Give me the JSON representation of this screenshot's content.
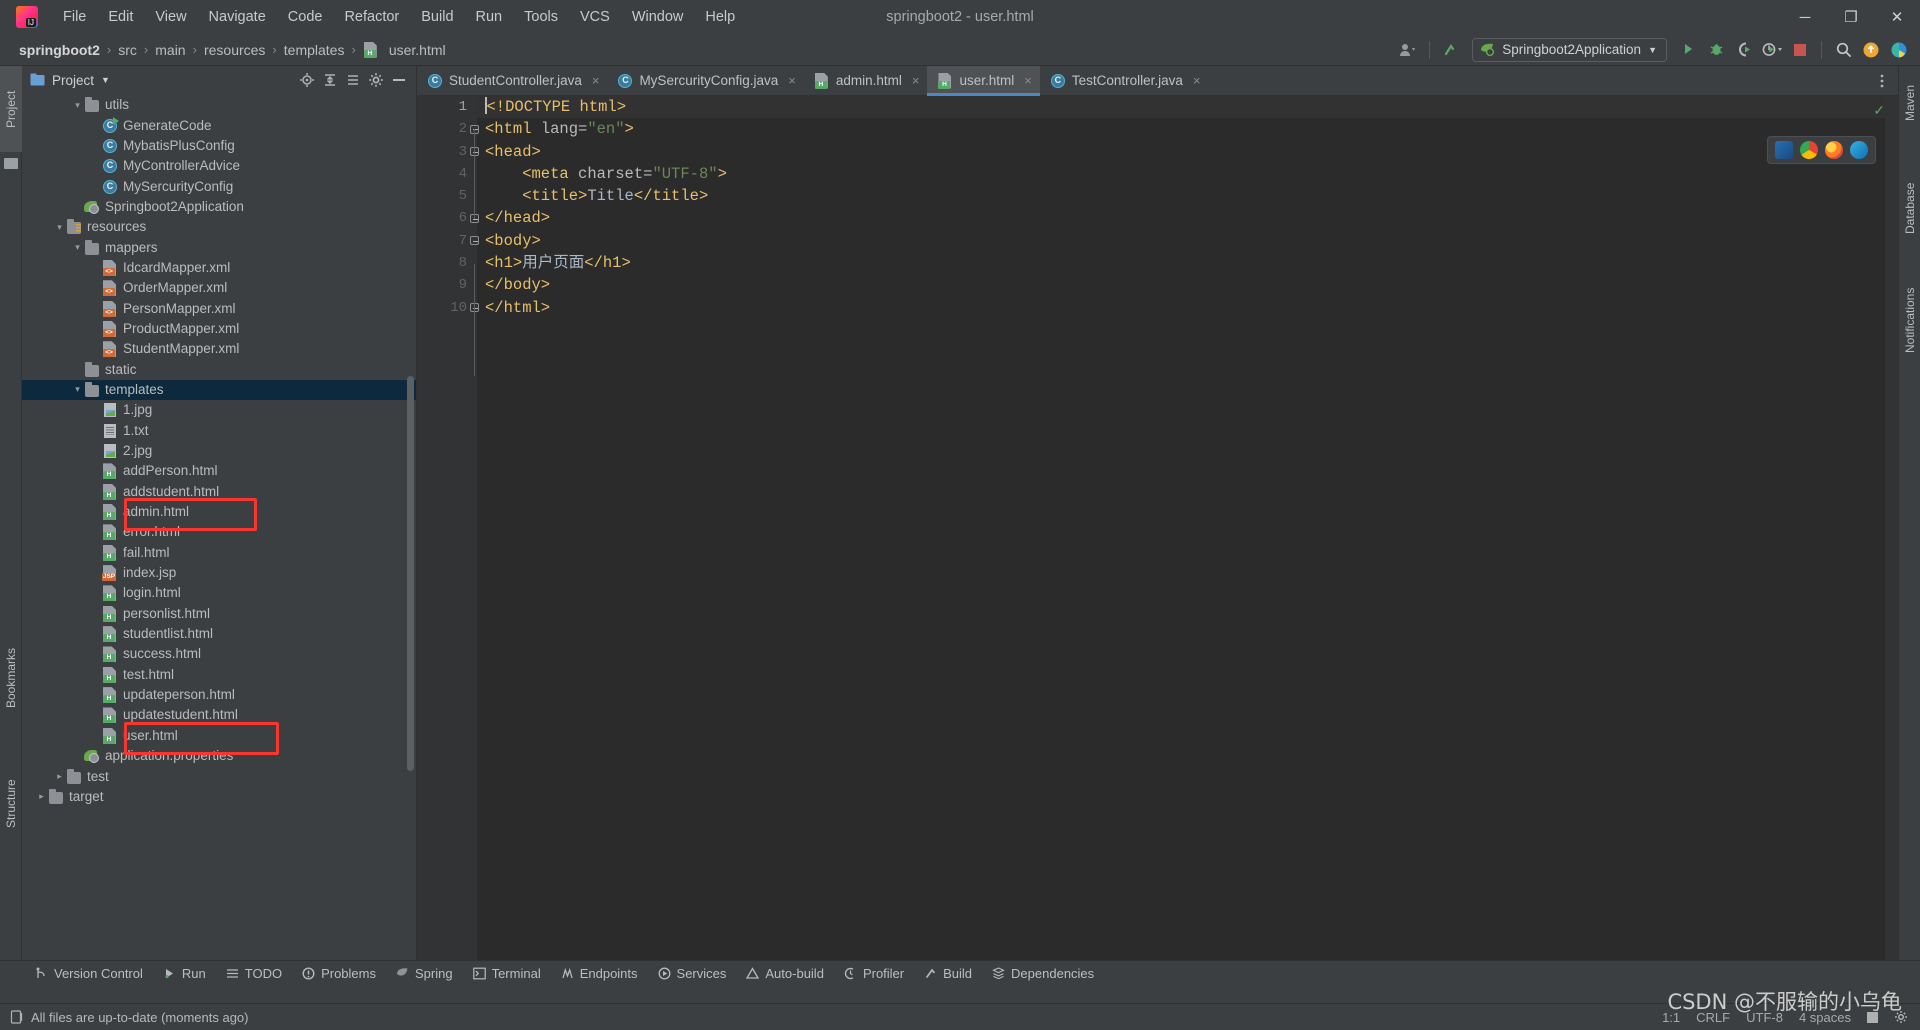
{
  "window": {
    "title": "springboot2 - user.html",
    "controls": {
      "minimize": "─",
      "maximize": "❐",
      "close": "✕"
    }
  },
  "menubar": {
    "items": [
      "File",
      "Edit",
      "View",
      "Navigate",
      "Code",
      "Refactor",
      "Build",
      "Run",
      "Tools",
      "VCS",
      "Window",
      "Help"
    ]
  },
  "breadcrumb": {
    "items": [
      "springboot2",
      "src",
      "main",
      "resources",
      "templates",
      "user.html"
    ],
    "separator": "›"
  },
  "toolbar": {
    "run_config": "Springboot2Application",
    "icons": [
      "user-avatar-icon",
      "updates-icon",
      "run-icon",
      "debug-icon",
      "run-coverage-icon",
      "profiler-icon",
      "stop-icon",
      "search-everywhere-icon",
      "notifications-icon",
      "ide-assistant-icon"
    ]
  },
  "left_tool_strip": {
    "tabs": [
      "Project",
      "Bookmarks",
      "Structure"
    ]
  },
  "right_tool_strip": {
    "tabs": [
      "Maven",
      "Database",
      "Notifications"
    ]
  },
  "project_panel": {
    "title": "Project",
    "header_icons": [
      "locate-icon",
      "expand-all-icon",
      "collapse-all-icon",
      "settings-icon",
      "hide-icon"
    ],
    "tree": [
      {
        "label": "utils",
        "type": "folder",
        "depth": 3,
        "twist": "expanded",
        "selected": false
      },
      {
        "label": "GenerateCode",
        "type": "class-run",
        "depth": 4,
        "twist": "",
        "selected": false
      },
      {
        "label": "MybatisPlusConfig",
        "type": "class",
        "depth": 4,
        "twist": "",
        "selected": false
      },
      {
        "label": "MyControllerAdvice",
        "type": "class",
        "depth": 4,
        "twist": "",
        "selected": false
      },
      {
        "label": "MySercurityConfig",
        "type": "class",
        "depth": 4,
        "twist": "",
        "selected": false
      },
      {
        "label": "Springboot2Application",
        "type": "spring",
        "depth": 3,
        "twist": "",
        "selected": false
      },
      {
        "label": "resources",
        "type": "folder-res",
        "depth": 2,
        "twist": "expanded",
        "selected": false
      },
      {
        "label": "mappers",
        "type": "folder",
        "depth": 3,
        "twist": "expanded",
        "selected": false
      },
      {
        "label": "IdcardMapper.xml",
        "type": "xml",
        "depth": 4,
        "twist": "",
        "selected": false
      },
      {
        "label": "OrderMapper.xml",
        "type": "xml",
        "depth": 4,
        "twist": "",
        "selected": false
      },
      {
        "label": "PersonMapper.xml",
        "type": "xml",
        "depth": 4,
        "twist": "",
        "selected": false
      },
      {
        "label": "ProductMapper.xml",
        "type": "xml",
        "depth": 4,
        "twist": "",
        "selected": false
      },
      {
        "label": "StudentMapper.xml",
        "type": "xml",
        "depth": 4,
        "twist": "",
        "selected": false
      },
      {
        "label": "static",
        "type": "folder",
        "depth": 3,
        "twist": "",
        "selected": false
      },
      {
        "label": "templates",
        "type": "folder",
        "depth": 3,
        "twist": "expanded",
        "selected": true
      },
      {
        "label": "1.jpg",
        "type": "image",
        "depth": 4,
        "twist": "",
        "selected": false
      },
      {
        "label": "1.txt",
        "type": "text",
        "depth": 4,
        "twist": "",
        "selected": false
      },
      {
        "label": "2.jpg",
        "type": "image",
        "depth": 4,
        "twist": "",
        "selected": false
      },
      {
        "label": "addPerson.html",
        "type": "html",
        "depth": 4,
        "twist": "",
        "selected": false
      },
      {
        "label": "addstudent.html",
        "type": "html",
        "depth": 4,
        "twist": "",
        "selected": false
      },
      {
        "label": "admin.html",
        "type": "html",
        "depth": 4,
        "twist": "",
        "selected": false
      },
      {
        "label": "error.html",
        "type": "html",
        "depth": 4,
        "twist": "",
        "selected": false
      },
      {
        "label": "fail.html",
        "type": "html",
        "depth": 4,
        "twist": "",
        "selected": false
      },
      {
        "label": "index.jsp",
        "type": "jsp",
        "depth": 4,
        "twist": "",
        "selected": false
      },
      {
        "label": "login.html",
        "type": "html",
        "depth": 4,
        "twist": "",
        "selected": false
      },
      {
        "label": "personlist.html",
        "type": "html",
        "depth": 4,
        "twist": "",
        "selected": false
      },
      {
        "label": "studentlist.html",
        "type": "html",
        "depth": 4,
        "twist": "",
        "selected": false
      },
      {
        "label": "success.html",
        "type": "html",
        "depth": 4,
        "twist": "",
        "selected": false
      },
      {
        "label": "test.html",
        "type": "html",
        "depth": 4,
        "twist": "",
        "selected": false
      },
      {
        "label": "updateperson.html",
        "type": "html",
        "depth": 4,
        "twist": "",
        "selected": false
      },
      {
        "label": "updatestudent.html",
        "type": "html",
        "depth": 4,
        "twist": "",
        "selected": false
      },
      {
        "label": "user.html",
        "type": "html",
        "depth": 4,
        "twist": "",
        "selected": false
      },
      {
        "label": "application.properties",
        "type": "spring",
        "depth": 3,
        "twist": "",
        "selected": false
      },
      {
        "label": "test",
        "type": "folder",
        "depth": 2,
        "twist": "collapsed",
        "selected": false
      },
      {
        "label": "target",
        "type": "folder",
        "depth": 1,
        "twist": "collapsed",
        "selected": false
      }
    ],
    "annotations": [
      {
        "name": "admin-html-highlight",
        "target": "admin.html"
      },
      {
        "name": "user-html-highlight",
        "target": "user.html"
      }
    ]
  },
  "editor": {
    "tabs": [
      {
        "label": "StudentController.java",
        "icon": "java-class-icon",
        "active": false
      },
      {
        "label": "MySercurityConfig.java",
        "icon": "java-class-icon",
        "active": false
      },
      {
        "label": "admin.html",
        "icon": "html-file-icon",
        "active": false
      },
      {
        "label": "user.html",
        "icon": "html-file-icon",
        "active": true
      },
      {
        "label": "TestController.java",
        "icon": "java-class-icon",
        "active": false
      }
    ],
    "close_glyph": "×",
    "lines": [
      {
        "n": "1",
        "fold": "",
        "tokens": [
          {
            "t": "tag",
            "v": "<!DOCTYPE html>"
          }
        ]
      },
      {
        "n": "2",
        "fold": "start",
        "tokens": [
          {
            "t": "tag",
            "v": "<html "
          },
          {
            "t": "attr",
            "v": "lang="
          },
          {
            "t": "str",
            "v": "\"en\""
          },
          {
            "t": "tag",
            "v": ">"
          }
        ]
      },
      {
        "n": "3",
        "fold": "start",
        "tokens": [
          {
            "t": "tag",
            "v": "<head>"
          }
        ]
      },
      {
        "n": "4",
        "fold": "",
        "tokens": [
          {
            "t": "tag",
            "v": "    <meta "
          },
          {
            "t": "attr",
            "v": "charset="
          },
          {
            "t": "str",
            "v": "\"UTF-8\""
          },
          {
            "t": "tag",
            "v": ">"
          }
        ]
      },
      {
        "n": "5",
        "fold": "",
        "tokens": [
          {
            "t": "tag",
            "v": "    <title>"
          },
          {
            "t": "txt",
            "v": "Title"
          },
          {
            "t": "tag",
            "v": "</title>"
          }
        ]
      },
      {
        "n": "6",
        "fold": "end",
        "tokens": [
          {
            "t": "tag",
            "v": "</head>"
          }
        ]
      },
      {
        "n": "7",
        "fold": "start",
        "tokens": [
          {
            "t": "tag",
            "v": "<body>"
          }
        ]
      },
      {
        "n": "8",
        "fold": "",
        "tokens": [
          {
            "t": "tag",
            "v": "<h1>"
          },
          {
            "t": "txt",
            "v": "用户页面"
          },
          {
            "t": "tag",
            "v": "</h1>"
          }
        ]
      },
      {
        "n": "9",
        "fold": "",
        "tokens": [
          {
            "t": "tag",
            "v": "</body>"
          }
        ]
      },
      {
        "n": "10",
        "fold": "end",
        "tokens": [
          {
            "t": "tag",
            "v": "</html>"
          }
        ]
      }
    ],
    "inspection_status": "✓",
    "browser_bar": [
      "ie-browser-icon",
      "chrome-browser-icon",
      "firefox-browser-icon",
      "edge-browser-icon"
    ]
  },
  "tool_window_bar": {
    "items": [
      {
        "label": "Version Control",
        "icon": "branch-icon"
      },
      {
        "label": "Run",
        "icon": "run-icon"
      },
      {
        "label": "TODO",
        "icon": "todo-icon"
      },
      {
        "label": "Problems",
        "icon": "problems-icon"
      },
      {
        "label": "Spring",
        "icon": "spring-icon"
      },
      {
        "label": "Terminal",
        "icon": "terminal-icon"
      },
      {
        "label": "Endpoints",
        "icon": "endpoints-icon"
      },
      {
        "label": "Services",
        "icon": "services-icon"
      },
      {
        "label": "Auto-build",
        "icon": "autobuild-icon"
      },
      {
        "label": "Profiler",
        "icon": "profiler-icon"
      },
      {
        "label": "Build",
        "icon": "build-icon"
      },
      {
        "label": "Dependencies",
        "icon": "dependencies-icon"
      }
    ]
  },
  "statusbar": {
    "message": "All files are up-to-date (moments ago)",
    "caret_position": "1:1",
    "line_separator": "CRLF",
    "encoding": "UTF-8",
    "indent": "4 spaces",
    "icons": [
      "memory-icon",
      "settings-gear-icon"
    ]
  },
  "watermark": {
    "text": "CSDN @不服输的小乌龟"
  },
  "colors": {
    "bg": "#3c3f41",
    "editor_bg": "#2b2b2b",
    "gutter_bg": "#313335",
    "selection": "#0d293e",
    "accent": "#4a88c7",
    "annotation_red": "#f8352f",
    "tag": "#e8bf6a",
    "string": "#6a8759",
    "text": "#a9b7c6",
    "green": "#59a869"
  }
}
